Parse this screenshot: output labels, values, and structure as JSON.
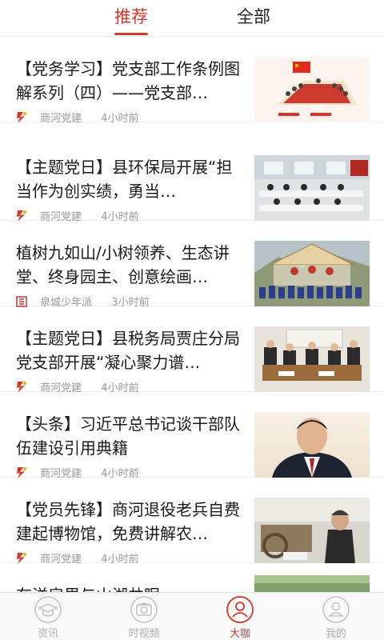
{
  "tabs": [
    {
      "label": "推荐",
      "active": true
    },
    {
      "label": "全部",
      "active": false
    }
  ],
  "articles": [
    {
      "title": "【党务学习】党支部工作条例图解系列（四）——党支部…",
      "source": "商河党建",
      "time": "4小时前"
    },
    {
      "title": "【主题党日】县环保局开展“担当作为创实绩，勇当…",
      "source": "商河党建",
      "time": "4小时前"
    },
    {
      "title": "植树九如山/小树领养、生态讲堂、终身园主、创意绘画…",
      "source": "泉城少年派",
      "time": "3小时前"
    },
    {
      "title": "【主题党日】县税务局贾庄分局党支部开展“凝心聚力谱…",
      "source": "商河党建",
      "time": "4小时前"
    },
    {
      "title": "【头条】习近平总书记谈干部队伍建设引用典籍",
      "source": "商河党建",
      "time": "4小时前"
    },
    {
      "title": "【党员先锋】商河退役老兵自费建起博物馆，免费讲解农…",
      "source": "商河党建",
      "time": "4小时前"
    },
    {
      "title": "在洋房里与山湖共眠",
      "source": "",
      "time": ""
    }
  ],
  "bottom_nav": [
    {
      "label": "资讯",
      "icon": "graduation-cap-icon",
      "active": false
    },
    {
      "label": "时视频",
      "icon": "camera-icon",
      "active": false
    },
    {
      "label": "大咖",
      "icon": "person-circle-icon",
      "active": true
    },
    {
      "label": "我的",
      "icon": "profile-card-icon",
      "active": false
    }
  ],
  "colors": {
    "accent": "#d8352a",
    "inactive": "#b0b0b0"
  }
}
